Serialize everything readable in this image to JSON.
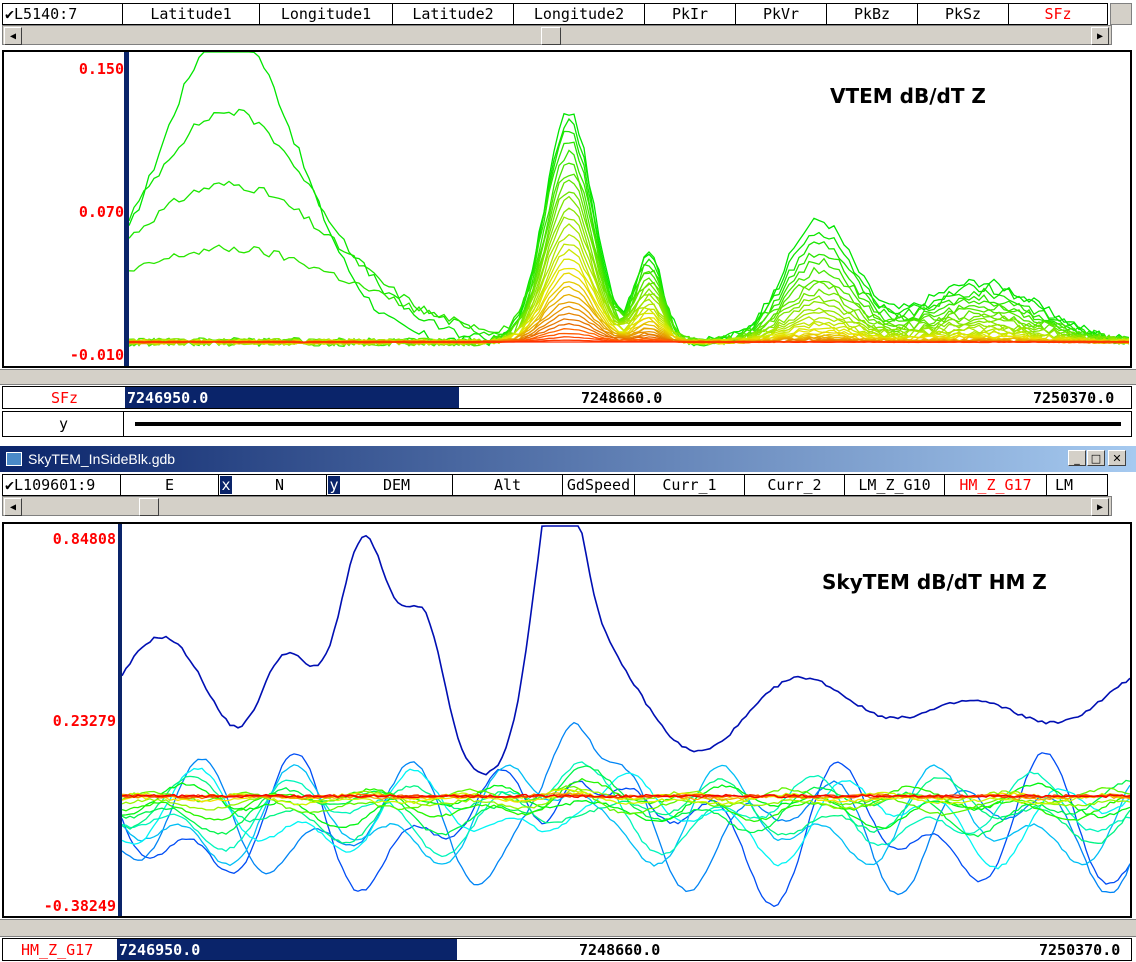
{
  "top": {
    "line_selector": "L5140:7",
    "columns": [
      "Latitude1",
      "Longitude1",
      "Latitude2",
      "Longitude2",
      "PkIr",
      "PkVr",
      "PkBz",
      "PkSz",
      "SFz"
    ],
    "active_column": "SFz",
    "chart_title": "VTEM dB/dT Z",
    "y_ticks": [
      "0.150",
      "0.070",
      "-0.010"
    ],
    "x_channel": "SFz",
    "x_ticks": [
      "7246950.0",
      "7248660.0",
      "7250370.0"
    ],
    "y_channel": "y"
  },
  "bottom": {
    "window_title": "SkyTEM_InSideBlk.gdb",
    "line_selector": "L109601:9",
    "columns": [
      "E",
      "x",
      "N",
      "y",
      "DEM",
      "Alt",
      "GdSpeed",
      "Curr_1",
      "Curr_2",
      "LM_Z_G10",
      "HM_Z_G17",
      "LM"
    ],
    "active_column": "HM_Z_G17",
    "chart_title": "SkyTEM dB/dT HM Z",
    "y_ticks": [
      "0.84808",
      "0.23279",
      "-0.38249"
    ],
    "x_channel": "HM_Z_G17",
    "x_ticks": [
      "7246950.0",
      "7248660.0",
      "7250370.0"
    ]
  },
  "icons": {
    "check": "checkmark-icon",
    "scroll_left": "arrow-left-icon",
    "scroll_right": "arrow-right-icon",
    "minimize": "minimize-icon",
    "maximize": "maximize-icon",
    "close": "close-icon"
  },
  "colors": {
    "axis_label": "#ff0000",
    "selection": "#0a246a",
    "title_bar": "#0a246a"
  }
}
